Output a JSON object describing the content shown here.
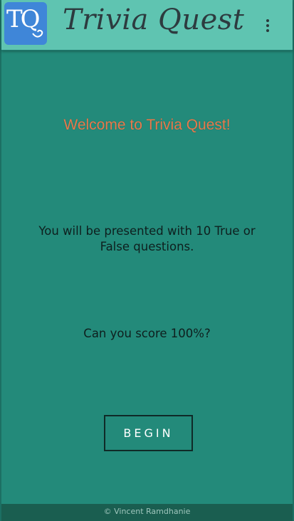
{
  "appbar": {
    "logo_text": "TQ",
    "title": "Trivia Quest",
    "menu_icon": "more-vert-icon"
  },
  "main": {
    "welcome": "Welcome to Trivia Quest!",
    "intro": "You will be presented with 10 True or False questions.",
    "challenge": "Can you score 100%?",
    "begin_label": "BEGIN"
  },
  "footer": {
    "credit": "© Vincent Ramdhanie"
  },
  "colors": {
    "background": "#238a7a",
    "appbar": "#5fc4b1",
    "logo": "#3f86d8",
    "welcome": "#e87a4c",
    "footer": "#1a5e50"
  }
}
